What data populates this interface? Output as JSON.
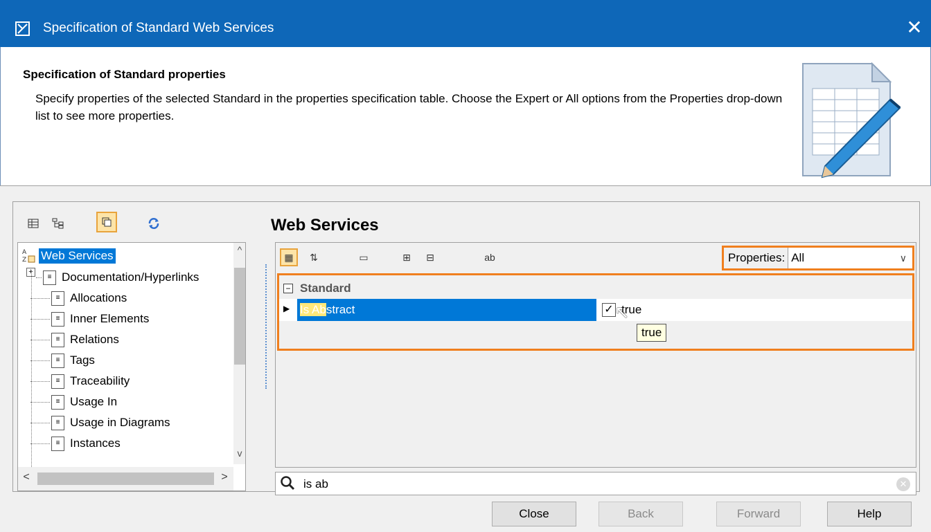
{
  "window": {
    "title": "Specification of Standard Web Services",
    "close_symbol": "✕"
  },
  "header": {
    "title": "Specification of Standard properties",
    "description": "Specify properties of the selected Standard in the properties specification table. Choose the Expert or All options from the Properties drop-down list to see more properties."
  },
  "left_toolbar": {
    "icons": [
      "table-icon",
      "tree-icon",
      "copy-icon",
      "refresh-icon"
    ]
  },
  "tree": {
    "root": "Web Services",
    "items": [
      "Documentation/Hyperlinks",
      "Allocations",
      "Inner Elements",
      "Relations",
      "Tags",
      "Traceability",
      "Usage In",
      "Usage in Diagrams",
      "Instances"
    ]
  },
  "section": {
    "title": "Web Services"
  },
  "properties_filter": {
    "label": "Properties:",
    "value": "All"
  },
  "props_table": {
    "group": "Standard",
    "rows": [
      {
        "name_highlight": "Is Ab",
        "name_rest": "stract",
        "value": "true",
        "checked": true
      }
    ],
    "tooltip": "true"
  },
  "search": {
    "query": "is ab"
  },
  "buttons": {
    "close": "Close",
    "back": "Back",
    "forward": "Forward",
    "help": "Help"
  },
  "colors": {
    "titlebar": "#0e67b8",
    "selection": "#0078d7",
    "highlight_border": "#f07f1e"
  }
}
